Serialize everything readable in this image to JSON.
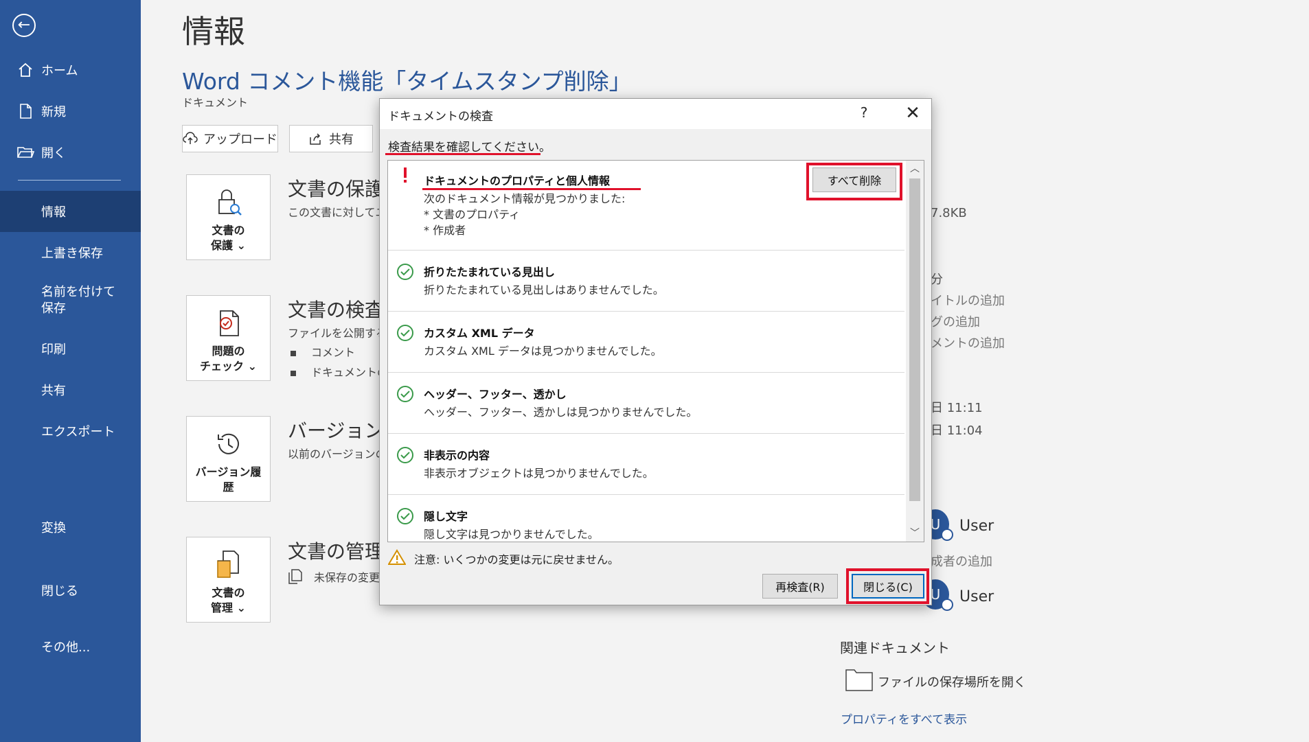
{
  "sidebar": {
    "back_label": "←",
    "items": [
      {
        "label": "ホーム"
      },
      {
        "label": "新規"
      },
      {
        "label": "開く"
      },
      {
        "label": "情報"
      },
      {
        "label": "上書き保存"
      },
      {
        "label": "名前を付けて保存"
      },
      {
        "label": "印刷"
      },
      {
        "label": "共有"
      },
      {
        "label": "エクスポート"
      },
      {
        "label": "変換"
      },
      {
        "label": "閉じる"
      },
      {
        "label": "その他..."
      }
    ],
    "active": "情報"
  },
  "main": {
    "page_title": "情報",
    "doc_title": "Word コメント機能「タイムスタンプ削除」",
    "doc_location": "ドキュメント",
    "upload_label": "アップロード",
    "share_label": "共有",
    "sections": [
      {
        "tile_label_1": "文書の",
        "tile_label_2": "保護 ⌄",
        "title": "文書の保護",
        "desc": "この文書に対してユ"
      },
      {
        "tile_label_1": "問題の",
        "tile_label_2": "チェック ⌄",
        "title": "文書の検査",
        "desc": "ファイルを公開する前",
        "bullets": [
          "コメント",
          "ドキュメントの"
        ]
      },
      {
        "tile_label_1": "バージョン履",
        "tile_label_2": "歴",
        "title": "バージョン履",
        "desc": "以前のバージョンの"
      },
      {
        "tile_label_1": "文書の",
        "tile_label_2": "管理 ⌄",
        "title": "文書の管理",
        "desc": "未保存の変更"
      }
    ]
  },
  "right_panel": {
    "size": "7.8KB",
    "pages_suffix": "分",
    "add_title": "イトルの追加",
    "add_tag": "グの追加",
    "add_comment": "メントの追加",
    "date1": "日 11:11",
    "date2": "日 11:04",
    "user1": "User",
    "user1_initial": "U",
    "add_author": "成者の追加",
    "user2": "User",
    "user2_initial": "U",
    "related_docs": "関連ドキュメント",
    "open_location": "ファイルの保存場所を開く",
    "show_all_props": "プロパティをすべて表示"
  },
  "dialog": {
    "title": "ドキュメントの検査",
    "help": "?",
    "close": "✕",
    "instruction": "検査結果を確認してください。",
    "remove_all": "すべて削除",
    "results": [
      {
        "status": "warning",
        "title": "ドキュメントのプロパティと個人情報",
        "desc": [
          "次のドキュメント情報が見つかりました:",
          "* 文書のプロパティ",
          "* 作成者"
        ]
      },
      {
        "status": "ok",
        "title": "折りたたまれている見出し",
        "desc": [
          "折りたたまれている見出しはありませんでした。"
        ]
      },
      {
        "status": "ok",
        "title": "カスタム XML データ",
        "desc": [
          "カスタム XML データは見つかりませんでした。"
        ]
      },
      {
        "status": "ok",
        "title": "ヘッダー、フッター、透かし",
        "desc": [
          "ヘッダー、フッター、透かしは見つかりませんでした。"
        ]
      },
      {
        "status": "ok",
        "title": "非表示の内容",
        "desc": [
          "非表示オブジェクトは見つかりませんでした。"
        ]
      },
      {
        "status": "ok",
        "title": "隠し文字",
        "desc": [
          "隠し文字は見つかりませんでした。"
        ]
      }
    ],
    "warning": "注意: いくつかの変更は元に戻せません。",
    "reinspect": "再検査(R)",
    "close_button": "閉じる(C)",
    "colors": {
      "highlight": "#e0112b",
      "ok": "#3a9a4a",
      "accent": "#2b579a"
    }
  }
}
